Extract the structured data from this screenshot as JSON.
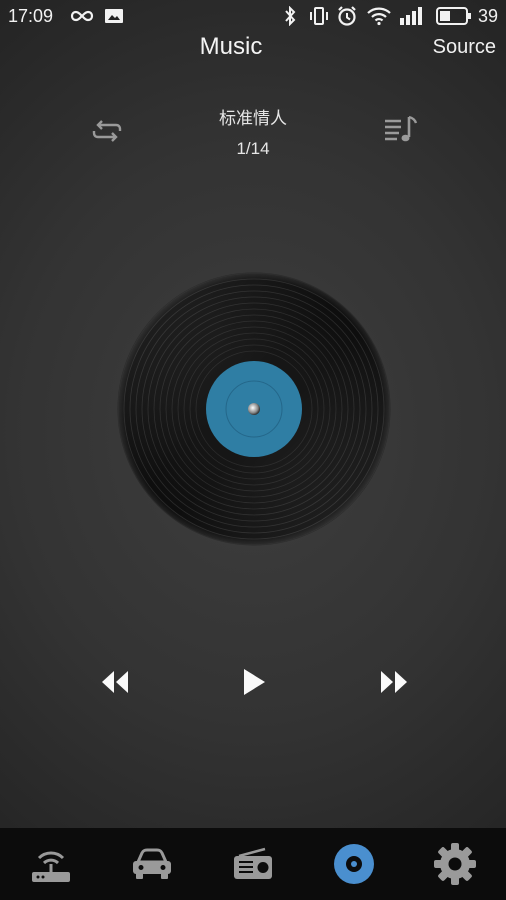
{
  "status": {
    "time": "17:09",
    "battery_level": "39"
  },
  "header": {
    "title": "Music",
    "source_label": "Source"
  },
  "track": {
    "name": "标准情人",
    "index": "1/14"
  },
  "colors": {
    "accent": "#4a8fcf",
    "label": "#2f7ea4",
    "icon": "#9a9a9a",
    "nav_bg": "#0c0c0c"
  },
  "nav": {
    "items": [
      {
        "icon": "router-icon",
        "active": false
      },
      {
        "icon": "car-icon",
        "active": false
      },
      {
        "icon": "radio-icon",
        "active": false
      },
      {
        "icon": "disc-icon",
        "active": true
      },
      {
        "icon": "gear-icon",
        "active": false
      }
    ]
  }
}
